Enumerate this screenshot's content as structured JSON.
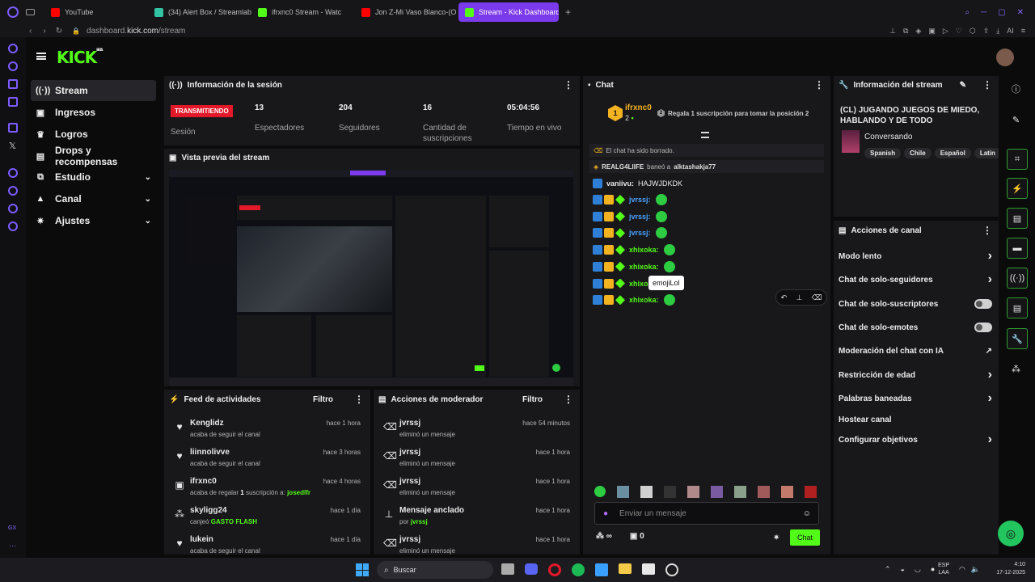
{
  "browser": {
    "tabs": [
      {
        "label": "YouTube",
        "color": "#ff0000"
      },
      {
        "label": "(34) Alert Box / Streamlab",
        "color": "#31c3a2"
      },
      {
        "label": "ifrxnc0 Stream - Watc",
        "color": "#53fc18"
      },
      {
        "label": "Jon Z-Mi Vaso Blanco-(O",
        "color": "#ff0000"
      },
      {
        "label": "Stream - Kick Dashboard",
        "color": "#53fc18"
      }
    ],
    "url_prefix": "dashboard.",
    "url_domain": "kick.com",
    "url_path": "/stream",
    "ai_label": "AI"
  },
  "app": {
    "logo": "KICK",
    "logo_sup": "BETA",
    "accent": "#53fc18"
  },
  "sidebar": {
    "items": [
      {
        "label": "Stream",
        "icon": "broadcast-icon",
        "glyph": "((·))"
      },
      {
        "label": "Ingresos",
        "icon": "wallet-icon",
        "glyph": "▣"
      },
      {
        "label": "Logros",
        "icon": "trophy-icon",
        "glyph": "♛"
      },
      {
        "label": "Drops y recompensas",
        "icon": "gift-icon",
        "glyph": "▤"
      },
      {
        "label": "Estudio",
        "icon": "studio-icon",
        "glyph": "⧉"
      },
      {
        "label": "Canal",
        "icon": "channel-icon",
        "glyph": "▲"
      },
      {
        "label": "Ajustes",
        "icon": "gear-icon",
        "glyph": "✷"
      }
    ]
  },
  "session": {
    "title": "Información de la sesión",
    "live_badge": "TRANSMITIENDO",
    "live_label": "Sesión",
    "stats": [
      {
        "value": "13",
        "label": "Espectadores"
      },
      {
        "value": "204",
        "label": "Seguidores"
      },
      {
        "value": "16",
        "label": "Cantidad de suscripciones"
      },
      {
        "value": "05:04:56",
        "label": "Tiempo en vivo"
      }
    ]
  },
  "preview": {
    "title": "Vista previa del stream"
  },
  "feed": {
    "title": "Feed de actividades",
    "filter": "Filtro",
    "items": [
      {
        "name": "Kenglidz",
        "desc": "acaba de seguir el canal",
        "time": "hace 1 hora",
        "icon": "heart-icon",
        "glyph": "♥"
      },
      {
        "name": "liinnolivve",
        "desc": "acaba de seguir el canal",
        "time": "hace 3 horas",
        "icon": "heart-icon",
        "glyph": "♥"
      },
      {
        "name": "ifrxnc0",
        "desc_a": "acaba de regalar ",
        "desc_b": "1",
        "desc_c": " suscripción a: ",
        "desc_d": "josedlfr",
        "time": "hace 4 horas",
        "icon": "gift-icon",
        "glyph": "▣"
      },
      {
        "name": "skyligg24",
        "desc_a": "canjeó ",
        "desc_d": "GASTO FLASH",
        "time": "hace 1 día",
        "icon": "points-icon",
        "glyph": "⁂"
      },
      {
        "name": "lukein",
        "desc": "acaba de seguir el canal",
        "time": "hace 1 día",
        "icon": "heart-icon",
        "glyph": "♥"
      }
    ]
  },
  "mod": {
    "title": "Acciones de moderador",
    "filter": "Filtro",
    "items": [
      {
        "name": "jvrssj",
        "desc": "eliminó un mensaje",
        "time": "hace 54 minutos",
        "icon": "trash-icon",
        "glyph": "🗑"
      },
      {
        "name": "jvrssj",
        "desc": "eliminó un mensaje",
        "time": "hace 1 hora",
        "icon": "trash-icon",
        "glyph": "🗑"
      },
      {
        "name": "jvrssj",
        "desc": "eliminó un mensaje",
        "time": "hace 1 hora",
        "icon": "trash-icon",
        "glyph": "🗑"
      },
      {
        "name": "Mensaje anclado",
        "desc_a": "por ",
        "desc_d": "jvrssj",
        "time": "hace 1 hora",
        "icon": "pin-icon",
        "glyph": "⊥"
      },
      {
        "name": "jvrssj",
        "desc": "eliminó un mensaje",
        "time": "hace 1 hora",
        "icon": "trash-icon",
        "glyph": "🗑"
      }
    ]
  },
  "chat": {
    "title": "Chat",
    "top_user": "ifrxnc0",
    "top_count": "2",
    "rank": "1",
    "gift_prompt_rank": "2",
    "gift_prompt": "Regala 1 suscripción para tomar la posición 2",
    "cleared": "El chat ha sido borrado.",
    "ban_user": "REALG4LIIFE",
    "ban_text": "baneó a",
    "ban_target": "alktashakja77",
    "first_msg_user": "vaniivu:",
    "first_msg_text": "HAJWJDKDK",
    "messages": [
      {
        "user": "jvrssj:",
        "color": "#4aa3ff"
      },
      {
        "user": "jvrssj:",
        "color": "#4aa3ff"
      },
      {
        "user": "jvrssj:",
        "color": "#4aa3ff"
      },
      {
        "user": "xhixoka:",
        "color": "#53fc18"
      },
      {
        "user": "xhixoka:",
        "color": "#53fc18"
      },
      {
        "user": "xhixoka:",
        "color": "#53fc18"
      },
      {
        "user": "xhixoka:",
        "color": "#53fc18"
      }
    ],
    "tooltip": "emojiLol",
    "input_placeholder": "Enviar un mensaje",
    "points_symbol": "∞",
    "count": "0",
    "send": "Chat"
  },
  "stream_info": {
    "title": "Información del stream",
    "stream_title": "(CL) JUGANDO JUEGOS DE MIEDO, HABLANDO Y DE TODO",
    "category": "Conversando",
    "tags": [
      "Spanish",
      "Chile",
      "Español",
      "Latin"
    ]
  },
  "channel_actions": {
    "title": "Acciones de canal",
    "items": [
      {
        "label": "Modo lento",
        "type": "arrow"
      },
      {
        "label": "Chat de solo-seguidores",
        "type": "arrow"
      },
      {
        "label": "Chat de solo-suscriptores",
        "type": "toggle"
      },
      {
        "label": "Chat de solo-emotes",
        "type": "toggle"
      },
      {
        "label": "Moderación del chat con IA",
        "type": "external"
      },
      {
        "label": "Restricción de edad",
        "type": "arrow"
      },
      {
        "label": "Palabras baneadas",
        "type": "arrow"
      },
      {
        "label": "Hostear canal",
        "type": "none"
      },
      {
        "label": "Configurar objetivos",
        "type": "arrow"
      }
    ]
  },
  "taskbar": {
    "search": "Buscar",
    "lang_top": "ESP",
    "lang_bottom": "LAA",
    "time": "4:10",
    "date": "17-12-2025"
  }
}
